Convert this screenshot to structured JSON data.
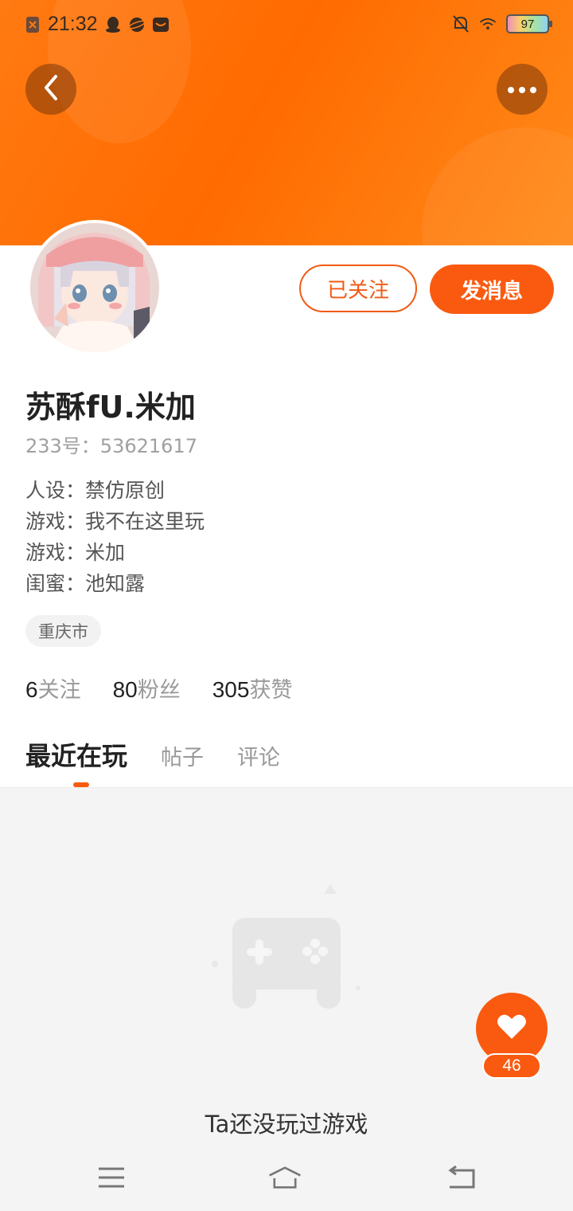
{
  "status_bar": {
    "time": "21:32",
    "battery": "97",
    "left_icons": [
      "sim-x-icon",
      "qq-icon",
      "planet-icon",
      "app-icon"
    ],
    "right_icons": [
      "mute-bell-icon",
      "wifi-icon",
      "battery-icon"
    ]
  },
  "header": {
    "back_icon": "chevron-left-icon",
    "more_icon": "more-dots-icon",
    "accent": "#fa5a0f"
  },
  "profile": {
    "name": "苏酥fU.米加",
    "uid": "233号：53621617",
    "bio": [
      "人设：禁仿原创",
      "游戏：我不在这里玩",
      "游戏：米加",
      "闺蜜：池知露"
    ],
    "location_tag": "重庆市"
  },
  "actions": {
    "follow_label": "已关注",
    "message_label": "发消息"
  },
  "stats": [
    {
      "num": "6",
      "label": "关注"
    },
    {
      "num": "80",
      "label": "粉丝"
    },
    {
      "num": "305",
      "label": "获赞"
    }
  ],
  "tabs": [
    {
      "label": "最近在玩",
      "active": true
    },
    {
      "label": "帖子",
      "active": false
    },
    {
      "label": "评论",
      "active": false
    }
  ],
  "empty_state": {
    "text": "Ta还没玩过游戏",
    "icon": "gamepad-icon"
  },
  "like": {
    "count": "46",
    "icon": "heart-icon"
  },
  "nav_bar": {
    "icons": [
      "menu-icon",
      "home-icon",
      "back-icon"
    ]
  }
}
